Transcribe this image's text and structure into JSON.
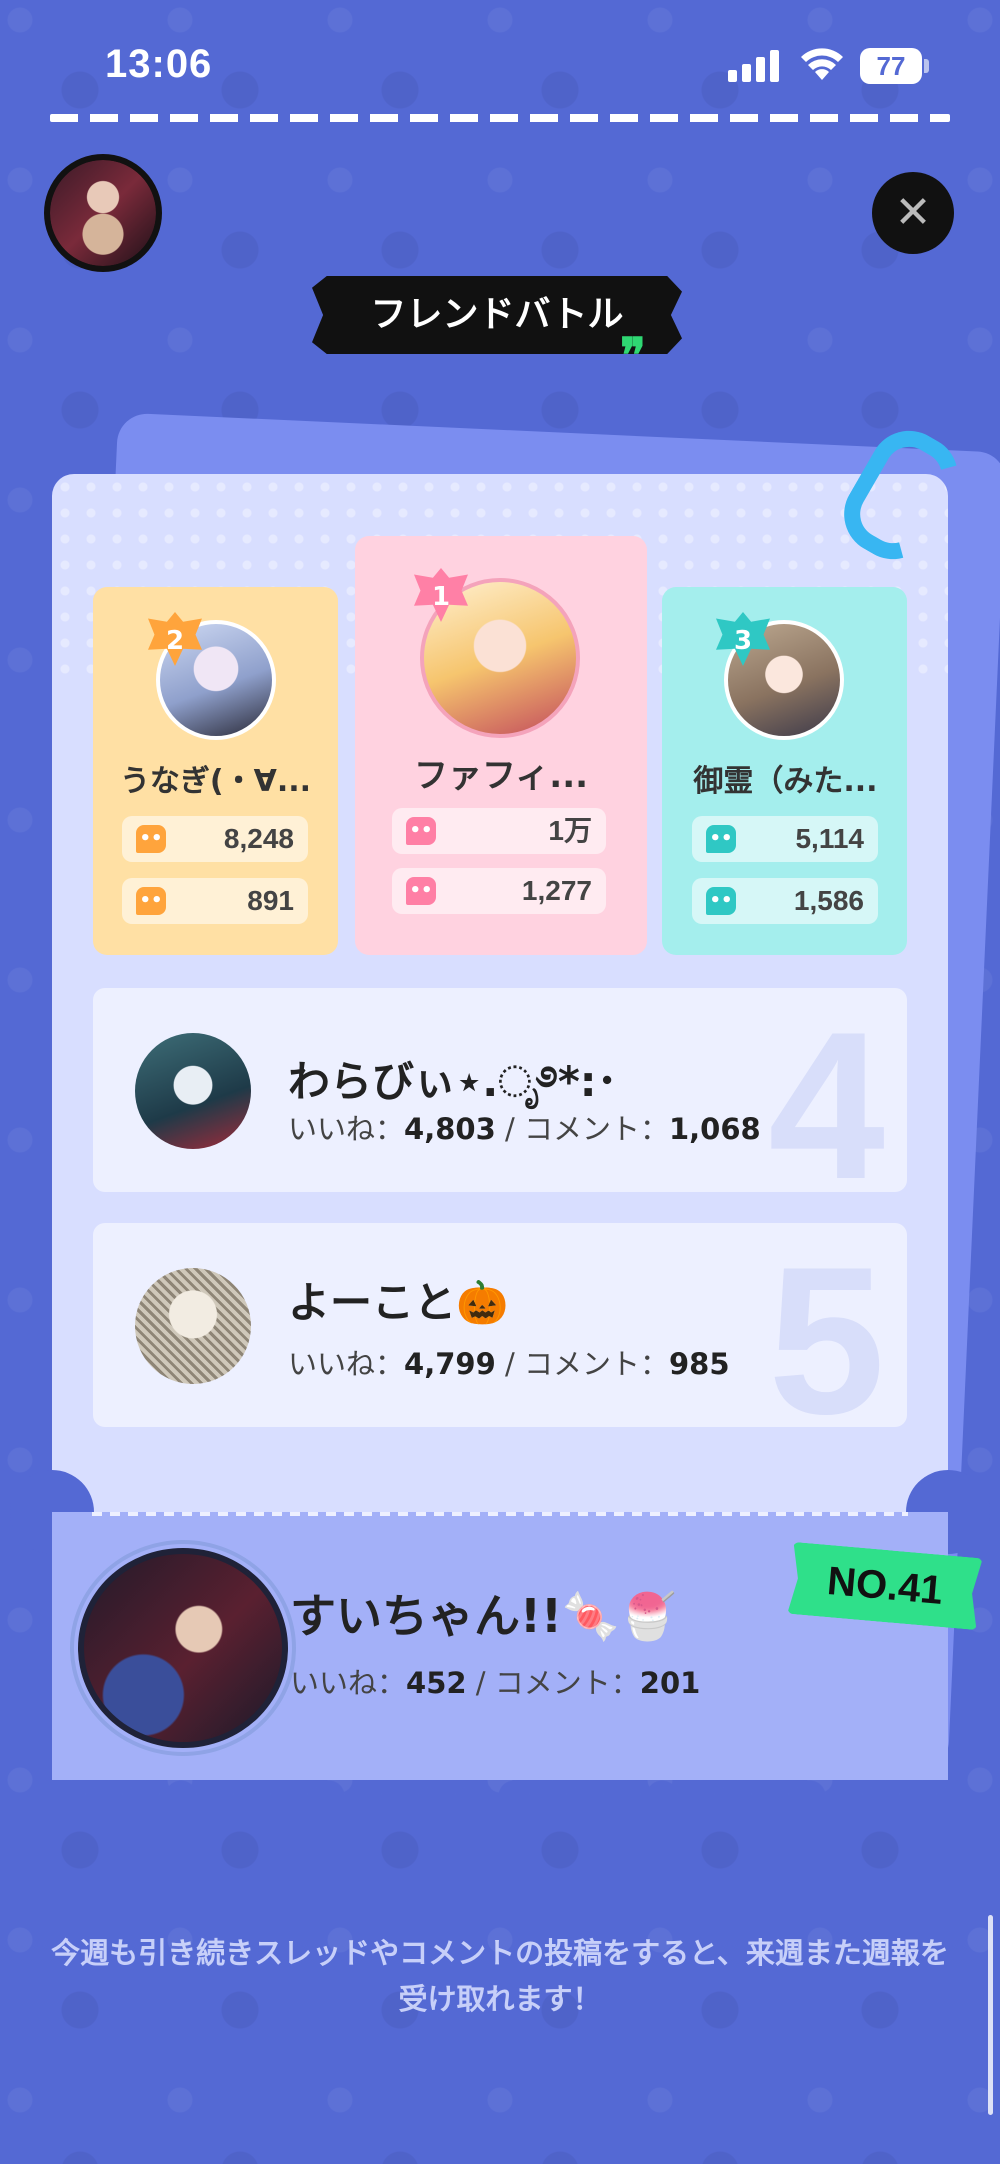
{
  "status_bar": {
    "time": "13:06",
    "battery": "77"
  },
  "title": "フレンドバトル",
  "close_glyph": "✕",
  "podium": [
    {
      "rank": "2",
      "name": "うなぎ(・∀...",
      "likes": "8,248",
      "comments": "891"
    },
    {
      "rank": "1",
      "name": "ファフィ...",
      "likes": "1万",
      "comments": "1,277"
    },
    {
      "rank": "3",
      "name": "御霊（みた...",
      "likes": "5,114",
      "comments": "1,586"
    }
  ],
  "ranking": [
    {
      "rank": "4",
      "name": "わらびぃ⋆.ೃ࿔*:･",
      "likes_label": "いいね：",
      "likes": "4,803",
      "sep": " / ",
      "comments_label": "コメント：",
      "comments": "1,068"
    },
    {
      "rank": "5",
      "name": "よーこと🎃",
      "likes_label": "いいね：",
      "likes": "4,799",
      "sep": " / ",
      "comments_label": "コメント：",
      "comments": "985"
    }
  ],
  "me": {
    "name": "すいちゃん!!🍬🍧",
    "likes_label": "いいね：",
    "likes": "452",
    "sep": " / ",
    "comments_label": "コメント：",
    "comments": "201",
    "rank_label": "NO.41"
  },
  "footer_note": "今週も引き続きスレッドやコメントの投稿をすると、来週また週報を受け取れます！",
  "colors": {
    "background": "#5469d4",
    "rank1": "#ffd2e0",
    "rank2": "#ffe0a4",
    "rank3": "#a4eeed",
    "badge": "#2fe08a"
  },
  "icons": {
    "like": "like-icon",
    "comment": "comment-icon",
    "close": "close-icon",
    "quote": "quote-icon",
    "clip": "paperclip-icon"
  }
}
